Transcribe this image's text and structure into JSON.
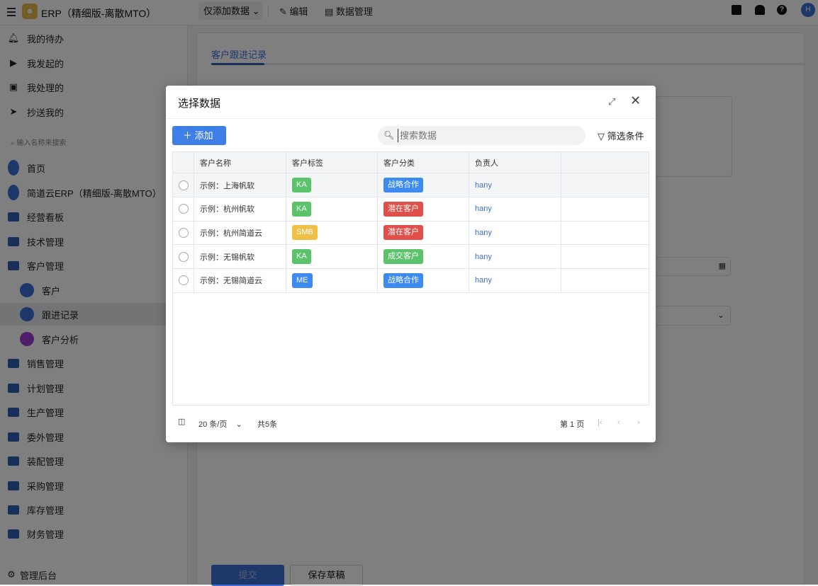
{
  "topbar": {
    "app_title": "ERP（精细版-离散MTO）",
    "mode": "仅添加数据",
    "edit": "编辑",
    "data_manage": "数据管理",
    "avatar": "H",
    "logo": "ERP"
  },
  "sidebar": {
    "top_items": [
      "我的待办",
      "我发起的",
      "我处理的",
      "抄送我的"
    ],
    "search_placeholder": "输入名称来搜索",
    "items": [
      {
        "label": "首页"
      },
      {
        "label": "简道云ERP（精细版-离散MTO）"
      },
      {
        "label": "经营看板"
      },
      {
        "label": "技术管理"
      },
      {
        "label": "客户管理"
      },
      {
        "label": "客户"
      },
      {
        "label": "跟进记录"
      },
      {
        "label": "客户分析"
      },
      {
        "label": "销售管理"
      },
      {
        "label": "计划管理"
      },
      {
        "label": "生产管理"
      },
      {
        "label": "委外管理"
      },
      {
        "label": "装配管理"
      },
      {
        "label": "采购管理"
      },
      {
        "label": "库存管理"
      },
      {
        "label": "财务管理"
      }
    ],
    "admin": "管理后台"
  },
  "form": {
    "tab": "客户跟进记录",
    "progress_percent": 9,
    "submit": "提交",
    "save_draft": "保存草稿"
  },
  "modal": {
    "title": "选择数据",
    "add": "添加",
    "search_placeholder": "搜索数据",
    "filter": "筛选条件",
    "columns": [
      "客户名称",
      "客户标签",
      "客户分类",
      "负责人"
    ],
    "rows": [
      {
        "name": "示例：上海帆软",
        "tag": "KA",
        "tag_color": "#5cc26b",
        "category": "战略合作",
        "cat_color": "#3d8af0",
        "owner": "hany"
      },
      {
        "name": "示例：杭州帆软",
        "tag": "KA",
        "tag_color": "#5cc26b",
        "category": "潜在客户",
        "cat_color": "#e0504a",
        "owner": "hany"
      },
      {
        "name": "示例：杭州简道云",
        "tag": "SMB",
        "tag_color": "#f0bf45",
        "category": "潜在客户",
        "cat_color": "#e0504a",
        "owner": "hany"
      },
      {
        "name": "示例：无锡帆软",
        "tag": "KA",
        "tag_color": "#5cc26b",
        "category": "成交客户",
        "cat_color": "#5cc26b",
        "owner": "hany"
      },
      {
        "name": "示例：无锡简道云",
        "tag": "ME",
        "tag_color": "#3d8af0",
        "category": "战略合作",
        "cat_color": "#3d8af0",
        "owner": "hany"
      }
    ],
    "page_size": "20 条/页",
    "total": "共5条",
    "page": "第 1 页"
  }
}
